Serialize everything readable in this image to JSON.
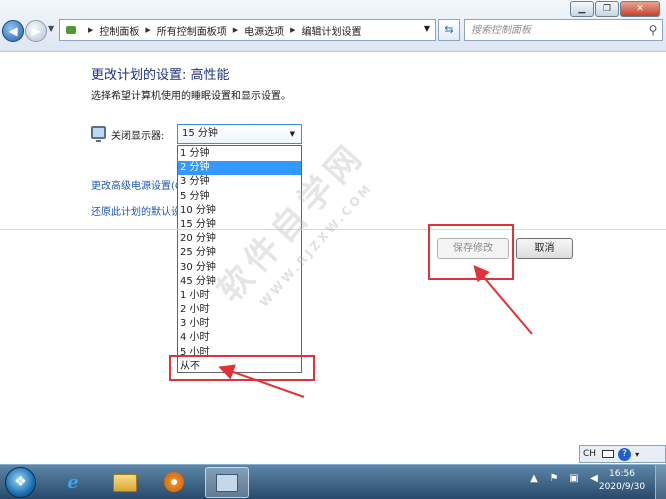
{
  "window": {
    "minimize_label": "▁",
    "maximize_label": "❐",
    "close_label": "✕"
  },
  "address": {
    "crumbs": [
      "控制面板",
      "所有控制面板项",
      "电源选项",
      "编辑计划设置"
    ]
  },
  "search": {
    "placeholder": "搜索控制面板"
  },
  "content": {
    "title": "更改计划的设置: 高性能",
    "subtitle": "选择希望计算机使用的睡眠设置和显示设置。",
    "display_off_label": "关闭显示器:",
    "display_off_value": "15 分钟",
    "options": [
      "1 分钟",
      "2 分钟",
      "3 分钟",
      "5 分钟",
      "10 分钟",
      "15 分钟",
      "20 分钟",
      "25 分钟",
      "30 分钟",
      "45 分钟",
      "1 小时",
      "2 小时",
      "3 小时",
      "4 小时",
      "5 小时",
      "从不"
    ],
    "highlighted_option": "2 分钟",
    "link_advanced": "更改高级电源设置(C)",
    "link_restore": "还原此计划的默认设置",
    "save_button": "保存修改",
    "cancel_button": "取消"
  },
  "watermark": {
    "text": "软件自学网",
    "url": "WWW.RJZXW.COM"
  },
  "taskbar": {
    "language": "CH",
    "time": "16:56",
    "date": "2020/9/30"
  },
  "colors": {
    "title_blue": "#1e3287",
    "link_blue": "#1c57b7",
    "highlight": "#3399ff",
    "annotation_red": "#e23237"
  }
}
